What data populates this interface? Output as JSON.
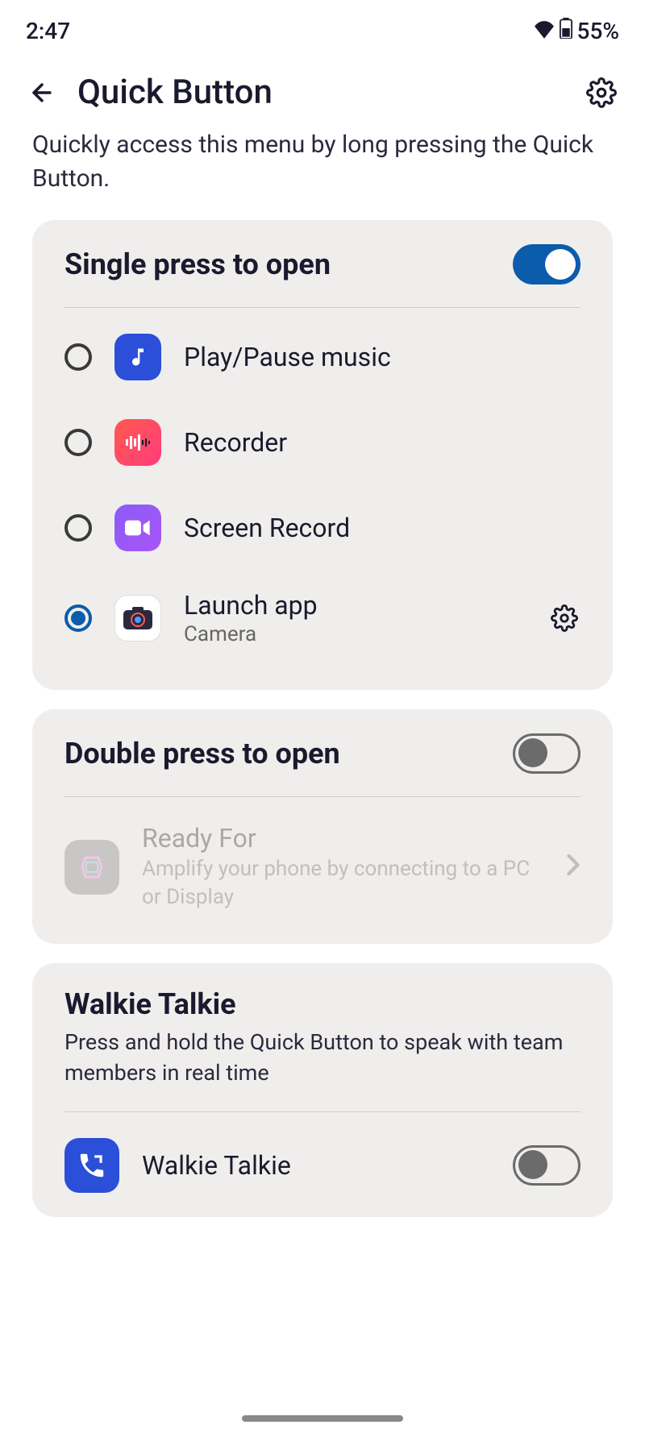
{
  "status": {
    "time": "2:47",
    "battery": "55%"
  },
  "header": {
    "title": "Quick Button"
  },
  "description": "Quickly access this menu by long pressing the Quick Button.",
  "single": {
    "title": "Single press to open",
    "enabled": true,
    "options": [
      {
        "label": "Play/Pause music",
        "selected": false,
        "icon_bg": "#2b4fd8"
      },
      {
        "label": "Recorder",
        "selected": false,
        "icon_bg": "linear-gradient(135deg,#ff5a4e,#ff3b7b)"
      },
      {
        "label": "Screen Record",
        "selected": false,
        "icon_bg": "linear-gradient(135deg,#8b5cf6,#a855f7)"
      },
      {
        "label": "Launch app",
        "sublabel": "Camera",
        "selected": true,
        "icon_bg": "#ffffff"
      }
    ]
  },
  "double": {
    "title": "Double press to open",
    "enabled": false,
    "ready_for": {
      "title": "Ready For",
      "desc": "Amplify your phone by connecting to a PC or Display"
    }
  },
  "walkie": {
    "title": "Walkie Talkie",
    "subtitle": "Press and hold the Quick Button to speak with team members in real time",
    "row_label": "Walkie Talkie",
    "enabled": false
  }
}
